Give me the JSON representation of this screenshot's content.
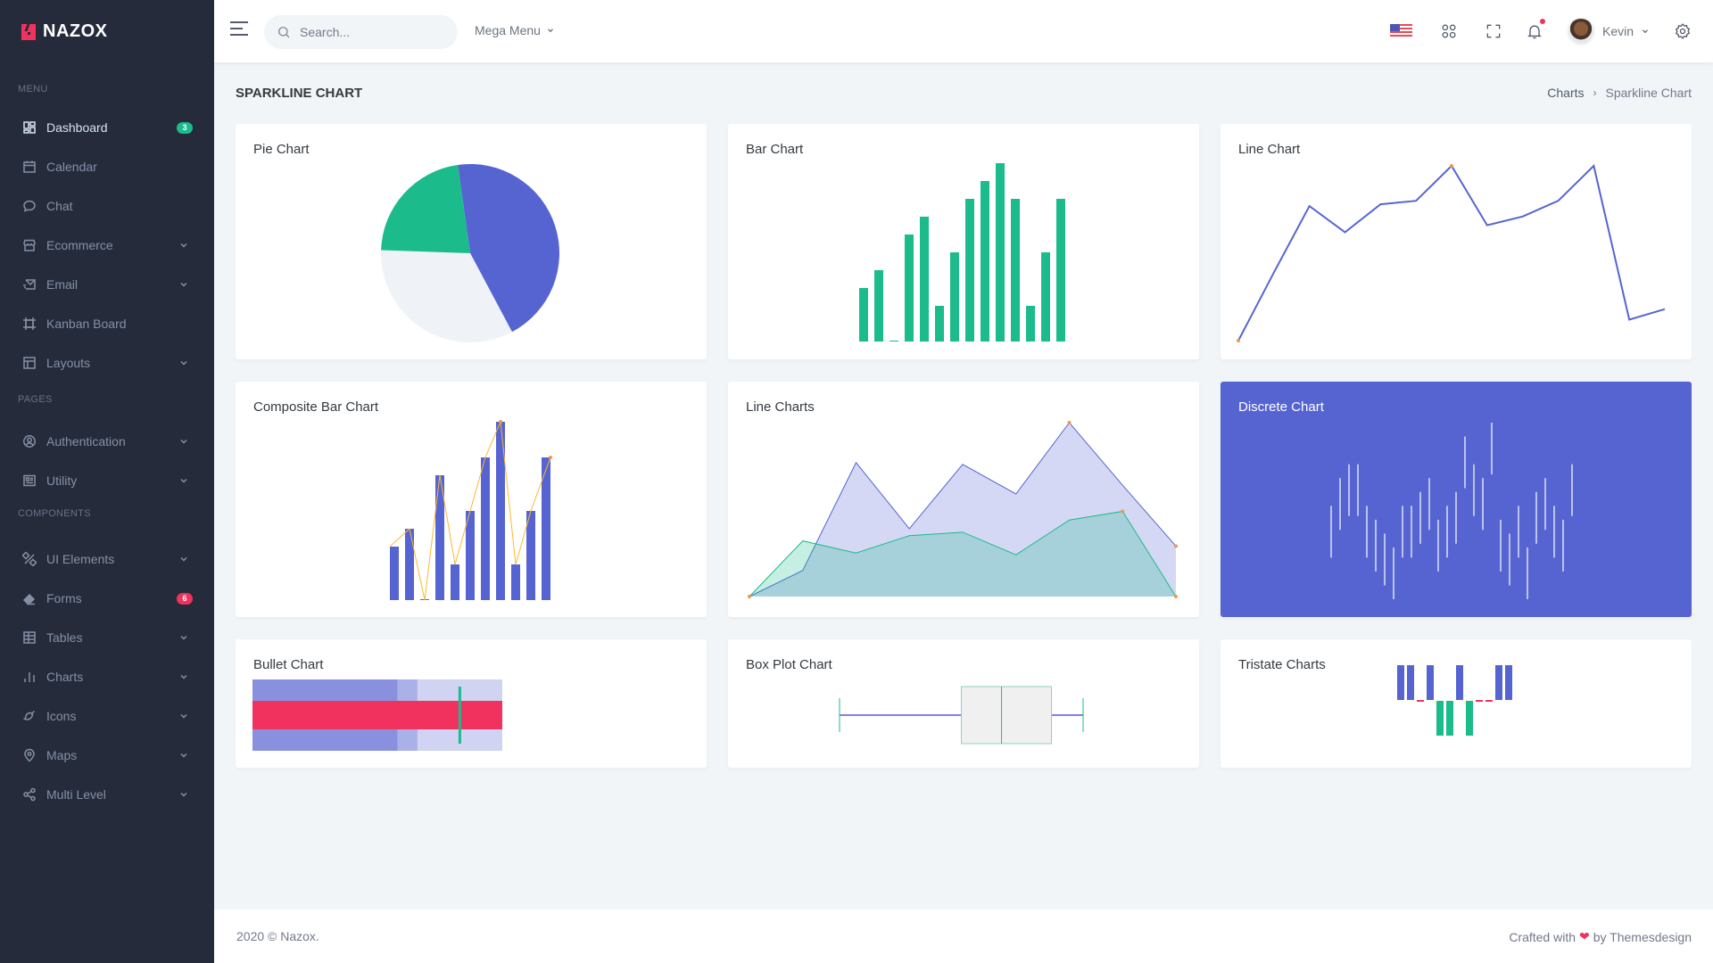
{
  "brand": {
    "name": "NAZOX"
  },
  "sidebar": {
    "sections": [
      {
        "title": "Menu"
      },
      {
        "title": "Pages"
      },
      {
        "title": "Components"
      }
    ],
    "items": [
      {
        "label": "Dashboard",
        "icon": "dashboard-icon",
        "badge": "3",
        "badge_color": "#1cbb8c",
        "active": true
      },
      {
        "label": "Calendar",
        "icon": "calendar-icon"
      },
      {
        "label": "Chat",
        "icon": "chat-icon"
      },
      {
        "label": "Ecommerce",
        "icon": "store-icon",
        "has_children": true
      },
      {
        "label": "Email",
        "icon": "mail-icon",
        "has_children": true
      },
      {
        "label": "Kanban Board",
        "icon": "artboard-icon"
      },
      {
        "label": "Layouts",
        "icon": "layout-icon",
        "has_children": true
      },
      {
        "label": "Authentication",
        "icon": "user-circle-icon",
        "has_children": true
      },
      {
        "label": "Utility",
        "icon": "profile-icon",
        "has_children": true
      },
      {
        "label": "UI Elements",
        "icon": "pencil-ruler-icon",
        "has_children": true
      },
      {
        "label": "Forms",
        "icon": "eraser-icon",
        "badge": "6",
        "badge_color": "#f1325e"
      },
      {
        "label": "Tables",
        "icon": "table-icon",
        "has_children": true
      },
      {
        "label": "Charts",
        "icon": "bar-chart-icon",
        "has_children": true
      },
      {
        "label": "Icons",
        "icon": "brush-icon",
        "has_children": true
      },
      {
        "label": "Maps",
        "icon": "map-pin-icon",
        "has_children": true
      },
      {
        "label": "Multi Level",
        "icon": "share-icon",
        "has_children": true
      }
    ]
  },
  "topbar": {
    "search_placeholder": "Search...",
    "mega_menu_label": "Mega Menu",
    "language_flag": "us-flag",
    "user_name": "Kevin",
    "has_notification": true
  },
  "page": {
    "title": "Sparkline Chart",
    "breadcrumb": [
      "Charts",
      "Sparkline Chart"
    ]
  },
  "colors": {
    "primary": "#5664d2",
    "success": "#1cbb8c",
    "danger": "#f1325e",
    "warning": "#fcb92c",
    "marker": "#f1974b",
    "light": "#eff2f7"
  },
  "chart_data": [
    {
      "id": "pie",
      "title": "Pie Chart",
      "type": "pie",
      "values": [
        4,
        3,
        2
      ],
      "colors": [
        "#5664d2",
        "#eff2f7",
        "#1cbb8c"
      ]
    },
    {
      "id": "bar",
      "title": "Bar Chart",
      "type": "bar",
      "values": [
        3,
        4,
        0,
        6,
        7,
        2,
        5,
        8,
        9,
        10,
        8,
        2,
        5,
        8
      ],
      "color": "#1cbb8c"
    },
    {
      "id": "line",
      "title": "Line Chart",
      "type": "line",
      "values": [
        0,
        3.9,
        7.7,
        6.2,
        7.8,
        8.0,
        10,
        6.6,
        7.1,
        8.0,
        10,
        1.2,
        1.8
      ],
      "color": "#5664d2",
      "marker_points": [
        0,
        6
      ]
    },
    {
      "id": "composite",
      "title": "Composite Bar Chart",
      "type": "bar",
      "values": [
        3,
        4,
        0,
        7,
        2,
        5,
        8,
        10,
        2,
        5,
        8
      ],
      "line_values": [
        3,
        4,
        0,
        7,
        2,
        5,
        8,
        10,
        2,
        5,
        8
      ],
      "bar_color": "#5664d2",
      "line_color": "#fcb92c"
    },
    {
      "id": "lines",
      "title": "Line Charts",
      "type": "area",
      "series": [
        {
          "name": "series-1",
          "values": [
            0,
            1.5,
            7.7,
            3.9,
            7.6,
            5.9,
            10,
            6.4,
            2.9
          ],
          "color": "#5664d2"
        },
        {
          "name": "series-2",
          "values": [
            0,
            3.2,
            2.5,
            3.5,
            3.7,
            2.4,
            4.4,
            4.9,
            0
          ],
          "color": "#1cbb8c"
        }
      ]
    },
    {
      "id": "discrete",
      "title": "Discrete Chart",
      "type": "discrete",
      "values": [
        6,
        8,
        9,
        9,
        6,
        5,
        4,
        3,
        6,
        6,
        7,
        8,
        5,
        6,
        7,
        11,
        9,
        8,
        12,
        5,
        4,
        6,
        3,
        7,
        8,
        6,
        5,
        9
      ],
      "color": "#ffffff",
      "background": "#5664d2"
    },
    {
      "id": "bullet",
      "title": "Bullet Chart",
      "type": "bullet",
      "target": 8.3,
      "performance": 10,
      "ranges": [
        10,
        6.6,
        5.8
      ],
      "range_max": 10,
      "range_colors": [
        "#d0d3f2",
        "#aab0e8",
        "#8991df"
      ],
      "performance_color": "#f1325e",
      "target_color": "#1cbb8c"
    },
    {
      "id": "box",
      "title": "Box Plot Chart",
      "type": "boxplot",
      "min": 0,
      "q1": 50,
      "median": 66.5,
      "q3": 87,
      "max": 100,
      "whisker_color": "#1cbb8c",
      "line_color": "#0000cc",
      "box_fill": "#f0f0f0",
      "box_border": "#8ad3ba"
    },
    {
      "id": "tristate",
      "title": "Tristate Charts",
      "type": "tristate",
      "values": [
        1,
        1,
        0,
        1,
        -1,
        -1,
        1,
        -1,
        0,
        0,
        1,
        1
      ],
      "pos_color": "#5664d2",
      "neg_color": "#1cbb8c",
      "zero_color": "#f1325e"
    }
  ],
  "footer": {
    "copyright": "2020 © Nazox.",
    "crafted_prefix": "Crafted with",
    "crafted_suffix": "by Themesdesign"
  }
}
